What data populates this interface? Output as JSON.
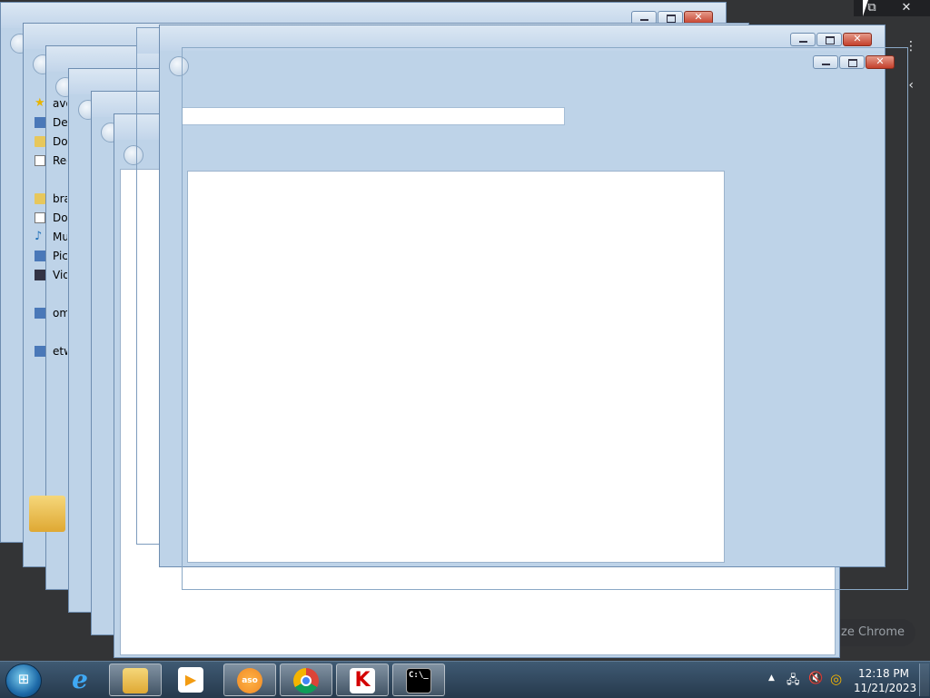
{
  "chrome": {
    "caption_minimize": "⧉",
    "caption_close": "✕",
    "menu_glyph": "⋮",
    "back_glyph": "‹",
    "customize_label": "mize Chrome"
  },
  "explorer": {
    "nav_items": [
      {
        "label": "avo",
        "icon": "star-icon"
      },
      {
        "label": "Des",
        "icon": "desktop-icon"
      },
      {
        "label": "Do",
        "icon": "downloads-icon"
      },
      {
        "label": "Rec",
        "icon": "recent-places-icon"
      },
      {
        "label": "",
        "icon": ""
      },
      {
        "label": "bra",
        "icon": "libraries-icon"
      },
      {
        "label": "Do",
        "icon": "documents-icon"
      },
      {
        "label": "Mu",
        "icon": "music-icon"
      },
      {
        "label": "Pic",
        "icon": "pictures-icon"
      },
      {
        "label": "Vid",
        "icon": "videos-icon"
      },
      {
        "label": "",
        "icon": ""
      },
      {
        "label": "om",
        "icon": "computer-icon"
      },
      {
        "label": "",
        "icon": ""
      },
      {
        "label": "etw",
        "icon": "network-icon"
      }
    ]
  },
  "taskbar": {
    "start_glyph": "⊞",
    "items": [
      {
        "name": "internet-explorer",
        "glyph": "e",
        "active": false
      },
      {
        "name": "windows-explorer",
        "glyph": "",
        "active": true
      },
      {
        "name": "media-player",
        "glyph": "▶",
        "active": false
      },
      {
        "name": "aso",
        "glyph": "aso",
        "active": true
      },
      {
        "name": "google-chrome",
        "glyph": "",
        "active": true
      },
      {
        "name": "kaspersky",
        "glyph": "K",
        "active": true
      },
      {
        "name": "command-prompt",
        "glyph": "C:\\_",
        "active": true
      }
    ],
    "tray": {
      "show_hidden": "▲",
      "network": "🖧",
      "volume": "🔇",
      "update": "◎"
    },
    "clock": {
      "time": "12:18 PM",
      "date": "11/21/2023"
    }
  }
}
